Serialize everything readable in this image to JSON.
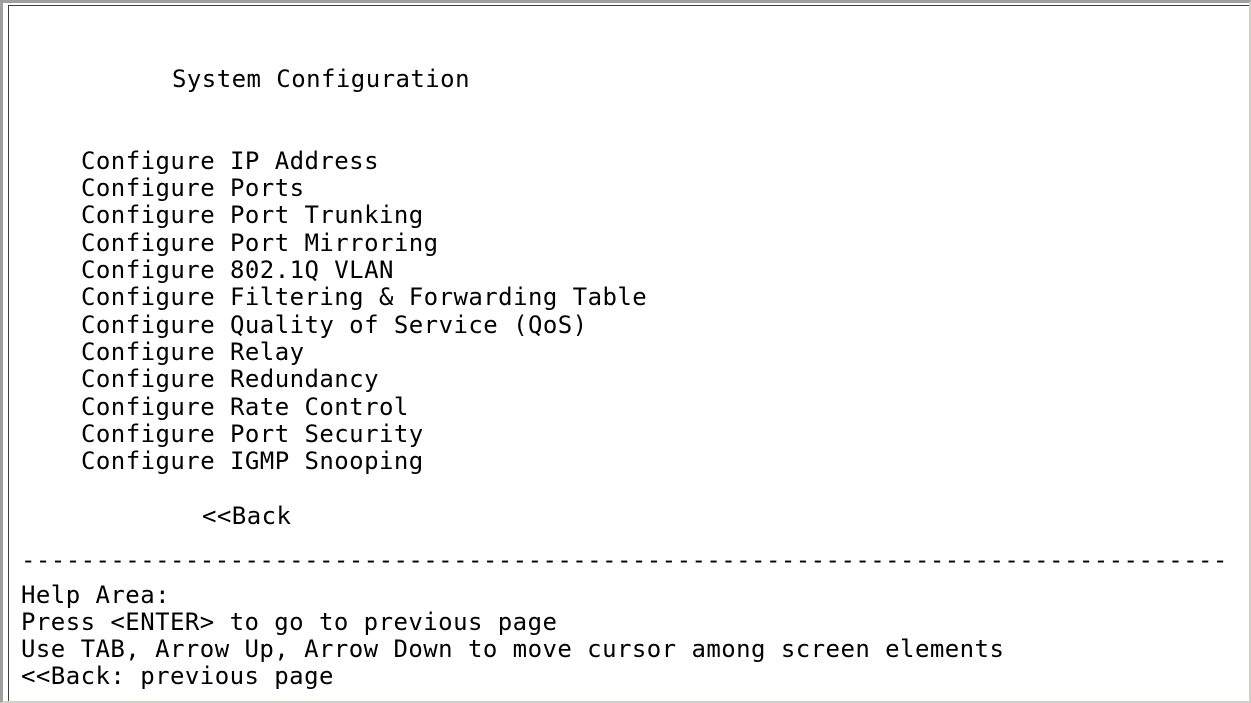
{
  "terminal": {
    "title": "System Configuration",
    "menu_items": [
      "Configure IP Address",
      "Configure Ports",
      "Configure Port Trunking",
      "Configure Port Mirroring",
      "Configure 802.1Q VLAN",
      "Configure Filtering & Forwarding Table",
      "Configure Quality of Service (QoS)",
      "Configure Relay",
      "Configure Redundancy",
      "Configure Rate Control",
      "Configure Port Security",
      "Configure IGMP Snooping"
    ],
    "back_label": "<<Back",
    "divider": "---------------------------------------------------------------------------------------",
    "help": {
      "heading": "Help Area:",
      "lines": [
        "Press <ENTER> to go to previous page",
        "Use TAB, Arrow Up, Arrow Down to move cursor among screen elements",
        "<<Back: previous page"
      ]
    }
  }
}
